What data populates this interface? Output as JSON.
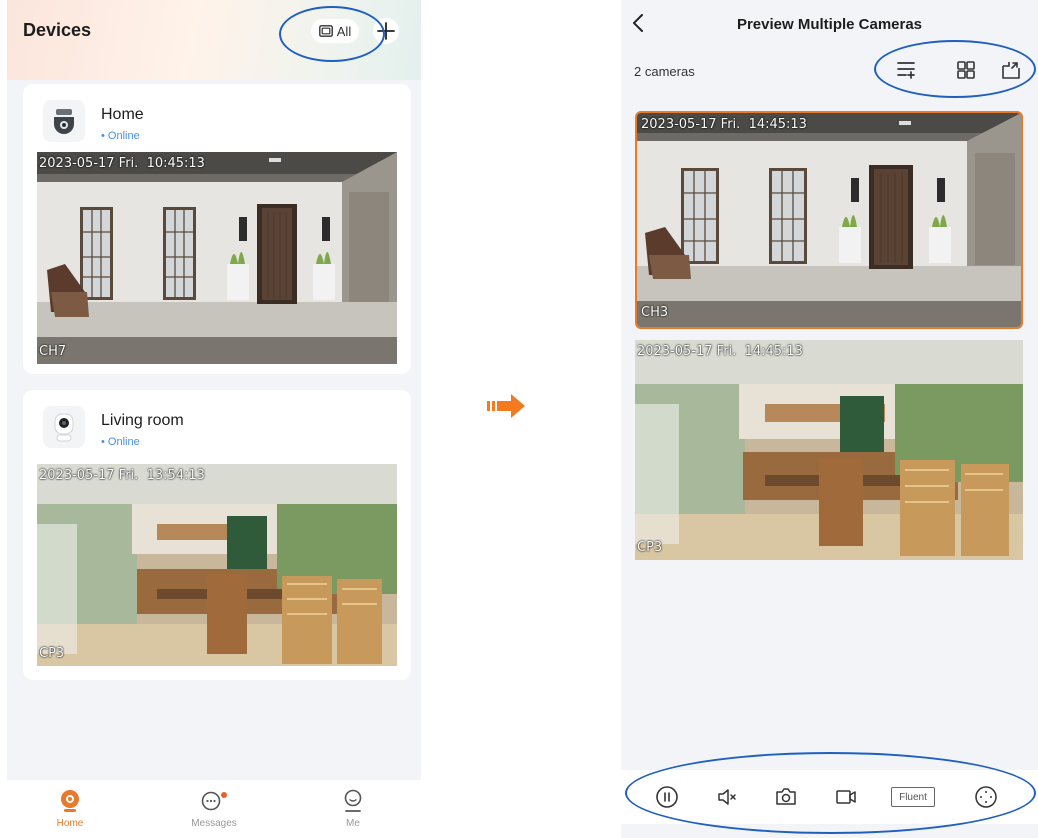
{
  "left": {
    "header_title": "Devices",
    "all_label": "All",
    "devices": [
      {
        "name": "Home",
        "status": "Online",
        "timestamp": "2023-05-17 Fri.  10:45:13",
        "channel": "CH7"
      },
      {
        "name": "Living room",
        "status": "Online",
        "timestamp": "2023-05-17 Fri.  13:54:13",
        "channel": "CP3"
      }
    ],
    "tabs": [
      {
        "label": "Home",
        "icon": "camera-home-icon",
        "active": true
      },
      {
        "label": "Messages",
        "icon": "chat-bubble-icon",
        "active": false
      },
      {
        "label": "Me",
        "icon": "user-icon",
        "active": false
      }
    ]
  },
  "right": {
    "title": "Preview Multiple Cameras",
    "camera_count": "2 cameras",
    "toolbar_icons": [
      "list-add-icon",
      "grid-icon",
      "export-icon"
    ],
    "feeds": [
      {
        "timestamp": "2023-05-17 Fri.  14:45:13",
        "channel": "CH3",
        "selected": true
      },
      {
        "timestamp": "2023-05-17 Fri.  14:45:13",
        "channel": "CP3",
        "selected": false
      }
    ],
    "controls": {
      "icons": [
        "pause-icon",
        "mute-icon",
        "snapshot-icon",
        "record-icon",
        "quality-button",
        "ptz-icon"
      ],
      "quality_label": "Fluent"
    }
  },
  "colors": {
    "accent": "#e87a2b",
    "online": "#4a90e2",
    "highlight_ellipse": "#1f5fbf",
    "badge": "#e8622c"
  }
}
